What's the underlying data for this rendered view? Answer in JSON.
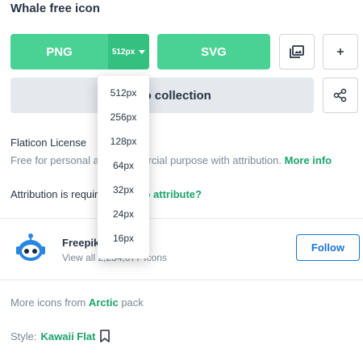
{
  "title": "Whale free icon",
  "download": {
    "png_label": "PNG",
    "size_selected": "512px",
    "svg_label": "SVG",
    "collection_label": "Add to collection"
  },
  "size_options": [
    "512px",
    "256px",
    "128px",
    "64px",
    "32px",
    "24px",
    "16px"
  ],
  "license": {
    "title": "Flaticon License",
    "text": "Free for personal and commercial purpose with attribution.",
    "more_info": "More info"
  },
  "attribution": {
    "text": "Attribution is required.",
    "link": "How to attribute?"
  },
  "author": {
    "name": "Freepik",
    "sub": "View all 2,234,077 Icons",
    "follow_label": "Follow"
  },
  "more_icons": {
    "prefix": "More icons from",
    "pack": "Arctic",
    "suffix": "pack"
  },
  "style": {
    "label": "Style:",
    "value": "Kawaii Flat"
  },
  "icons": {
    "gallery": "image-gallery-icon",
    "plus": "plus-icon",
    "share": "share-icon",
    "bookmark": "bookmark-icon",
    "avatar": "robot-avatar-icon"
  },
  "colors": {
    "green": "#4ad295",
    "green_dark": "#34c180",
    "link_green": "#1aa36a",
    "follow_blue": "#1a73d8",
    "avatar_blue": "#2a86e0"
  }
}
